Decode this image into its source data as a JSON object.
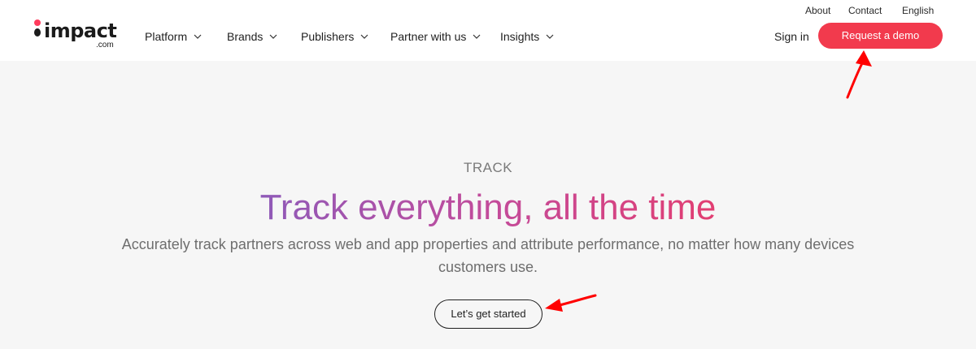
{
  "brand": {
    "name": "impact",
    "suffix": ".com"
  },
  "nav": {
    "items": [
      {
        "label": "Platform"
      },
      {
        "label": "Brands"
      },
      {
        "label": "Publishers"
      },
      {
        "label": "Partner with us"
      },
      {
        "label": "Insights"
      }
    ]
  },
  "utility": {
    "about": "About",
    "contact": "Contact",
    "language": "English"
  },
  "actions": {
    "sign_in": "Sign in",
    "request_demo": "Request a demo"
  },
  "hero": {
    "eyebrow": "TRACK",
    "title": "Track everything, all the time",
    "subtitle": "Accurately track partners across web and app properties and attribute performance, no matter how many devices customers use.",
    "cta": "Let’s get started"
  },
  "colors": {
    "accent": "#f23a4d",
    "annotation": "#ff0000",
    "gradient_start": "#8f5ab8",
    "gradient_end": "#e23e72"
  },
  "icons": {
    "nav_chevron": "chevron-down-icon",
    "annotation": "arrow-icon"
  }
}
